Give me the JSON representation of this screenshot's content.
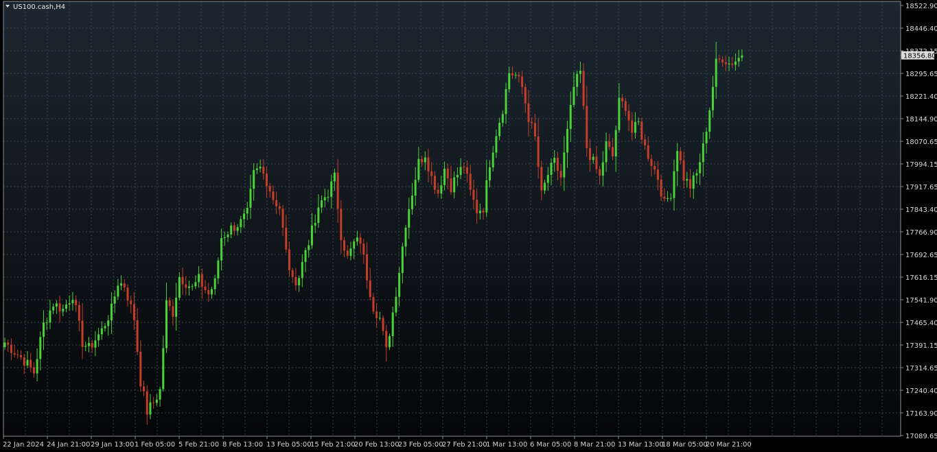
{
  "chart_window": {
    "symbol_label": "US100.cash,H4",
    "colors": {
      "background_top": "#1c2731",
      "background_bottom": "#050607",
      "grid": "#3a4450",
      "axis": "#8a8f96",
      "bull": "#4bd23a",
      "bear": "#c53e2a",
      "price_tag_bg": "#dcdcdc"
    }
  },
  "chart_data": {
    "type": "candlestick",
    "title": "US100.cash,H4",
    "ylim": [
      17089.65,
      18522.9
    ],
    "y_ticks": [
      "18522.90",
      "18446.40",
      "18372.15",
      "18295.65",
      "18221.40",
      "18144.90",
      "18070.65",
      "17994.15",
      "17917.65",
      "17843.40",
      "17766.90",
      "17692.65",
      "17616.15",
      "17541.90",
      "17465.40",
      "17391.15",
      "17314.65",
      "17240.40",
      "17163.90",
      "17089.65"
    ],
    "x_ticks": [
      "22 Jan 2024",
      "24 Jan 21:00",
      "29 Jan 13:00",
      "1 Feb 05:00",
      "5 Feb 21:00",
      "8 Feb 13:00",
      "13 Feb 05:00",
      "15 Feb 21:00",
      "20 Feb 13:00",
      "23 Feb 05:00",
      "27 Feb 21:00",
      "1 Mar 13:00",
      "6 Mar 05:00",
      "8 Mar 21:00",
      "13 Mar 13:00",
      "18 Mar 05:00",
      "20 Mar 21:00"
    ],
    "current_price": "18356.80",
    "grid": true,
    "anchors": [
      [
        0,
        17400
      ],
      [
        6,
        17340
      ],
      [
        9,
        17300
      ],
      [
        12,
        17460
      ],
      [
        15,
        17530
      ],
      [
        18,
        17510
      ],
      [
        21,
        17560
      ],
      [
        24,
        17400
      ],
      [
        26,
        17380
      ],
      [
        30,
        17440
      ],
      [
        33,
        17510
      ],
      [
        35,
        17600
      ],
      [
        37,
        17590
      ],
      [
        40,
        17480
      ],
      [
        42,
        17270
      ],
      [
        44,
        17170
      ],
      [
        46,
        17200
      ],
      [
        48,
        17240
      ],
      [
        50,
        17530
      ],
      [
        52,
        17500
      ],
      [
        54,
        17620
      ],
      [
        58,
        17580
      ],
      [
        60,
        17610
      ],
      [
        63,
        17560
      ],
      [
        65,
        17600
      ],
      [
        67,
        17750
      ],
      [
        70,
        17780
      ],
      [
        73,
        17800
      ],
      [
        75,
        17830
      ],
      [
        77,
        17960
      ],
      [
        79,
        17980
      ],
      [
        81,
        17940
      ],
      [
        83,
        17880
      ],
      [
        85,
        17850
      ],
      [
        87,
        17700
      ],
      [
        89,
        17600
      ],
      [
        91,
        17620
      ],
      [
        93,
        17710
      ],
      [
        96,
        17800
      ],
      [
        98,
        17870
      ],
      [
        100,
        17900
      ],
      [
        102,
        17950
      ],
      [
        104,
        17760
      ],
      [
        106,
        17680
      ],
      [
        108,
        17730
      ],
      [
        110,
        17740
      ],
      [
        112,
        17620
      ],
      [
        114,
        17520
      ],
      [
        116,
        17480
      ],
      [
        118,
        17370
      ],
      [
        120,
        17500
      ],
      [
        122,
        17640
      ],
      [
        124,
        17800
      ],
      [
        126,
        17900
      ],
      [
        128,
        18000
      ],
      [
        130,
        18030
      ],
      [
        132,
        17950
      ],
      [
        134,
        17900
      ],
      [
        136,
        17980
      ],
      [
        138,
        17920
      ],
      [
        140,
        17960
      ],
      [
        142,
        17990
      ],
      [
        144,
        17900
      ],
      [
        146,
        17840
      ],
      [
        148,
        17850
      ],
      [
        150,
        18000
      ],
      [
        152,
        18100
      ],
      [
        154,
        18180
      ],
      [
        156,
        18300
      ],
      [
        158,
        18290
      ],
      [
        160,
        18250
      ],
      [
        162,
        18150
      ],
      [
        164,
        18080
      ],
      [
        166,
        17890
      ],
      [
        168,
        17960
      ],
      [
        170,
        18000
      ],
      [
        172,
        17950
      ],
      [
        174,
        18100
      ],
      [
        176,
        18250
      ],
      [
        178,
        18300
      ],
      [
        180,
        18050
      ],
      [
        182,
        18000
      ],
      [
        184,
        17950
      ],
      [
        186,
        18060
      ],
      [
        188,
        18020
      ],
      [
        190,
        18200
      ],
      [
        192,
        18190
      ],
      [
        194,
        18100
      ],
      [
        196,
        18130
      ],
      [
        198,
        18050
      ],
      [
        200,
        18000
      ],
      [
        202,
        17950
      ],
      [
        204,
        17860
      ],
      [
        206,
        17900
      ],
      [
        208,
        18050
      ],
      [
        210,
        17950
      ],
      [
        212,
        17920
      ],
      [
        214,
        17960
      ],
      [
        216,
        18050
      ],
      [
        218,
        18180
      ],
      [
        220,
        18330
      ],
      [
        222,
        18350
      ],
      [
        224,
        18330
      ],
      [
        226,
        18340
      ],
      [
        228,
        18356.8
      ]
    ]
  }
}
